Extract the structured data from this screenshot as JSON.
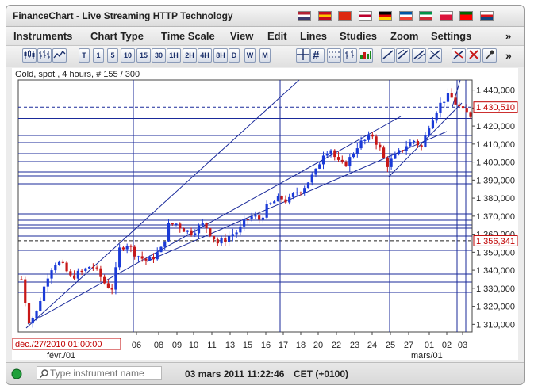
{
  "window": {
    "title": "FinanceChart - Live Streaming HTTP Technology"
  },
  "flags": [
    {
      "name": "flag-us-icon",
      "colors": [
        "#b22234",
        "#ffffff",
        "#3c3b6e"
      ]
    },
    {
      "name": "flag-spain-icon",
      "colors": [
        "#c60b1e",
        "#ffc400",
        "#c60b1e"
      ]
    },
    {
      "name": "flag-china-icon",
      "colors": [
        "#de2910",
        "#de2910",
        "#de2910"
      ]
    },
    {
      "name": "flag-japan-icon",
      "colors": [
        "#ffffff",
        "#bc002d",
        "#ffffff"
      ]
    },
    {
      "name": "flag-germany-icon",
      "colors": [
        "#000000",
        "#dd0000",
        "#ffce00"
      ]
    },
    {
      "name": "flag-france-icon",
      "colors": [
        "#0055a4",
        "#ffffff",
        "#ef4135"
      ]
    },
    {
      "name": "flag-italy-icon",
      "colors": [
        "#009246",
        "#ffffff",
        "#ce2b37"
      ]
    },
    {
      "name": "flag-poland-icon",
      "colors": [
        "#ffffff",
        "#dc143c",
        "#dc143c"
      ]
    },
    {
      "name": "flag-portugal-icon",
      "colors": [
        "#006600",
        "#ff0000",
        "#ff0000"
      ]
    },
    {
      "name": "flag-czech-icon",
      "colors": [
        "#ffffff",
        "#d7141a",
        "#11457e"
      ]
    }
  ],
  "menu": [
    "Instruments",
    "Chart Type",
    "Time Scale",
    "View",
    "Edit",
    "Lines",
    "Studies",
    "Zoom",
    "Settings"
  ],
  "menu_more": "»",
  "toolbar": {
    "chart_type_icons": [
      "candlestick-chart-icon",
      "bar-chart-icon",
      "line-chart-icon"
    ],
    "periods": [
      "T",
      "1",
      "5",
      "10",
      "15",
      "30",
      "1H",
      "2H",
      "4H",
      "8H",
      "D",
      "W",
      "M"
    ],
    "tools": [
      "crosshair-icon",
      "grid-icon",
      "dotted-line-icon",
      "ohlc-icon",
      "volume-icon",
      "draw-line-1-icon",
      "draw-line-2-icon",
      "draw-line-3-icon",
      "draw-line-4-icon",
      "remove-lines-icon",
      "delete-icon",
      "pin-icon"
    ],
    "more": "»"
  },
  "chart": {
    "header": "Gold, spot , 4 hours, # 155 / 300",
    "price_label_current": "1 430,510",
    "price_label_ref": "1 356,341",
    "crosshair_time": "déc./27/2010 01:00:00",
    "month_labels": [
      "févr./01",
      "mars/01"
    ],
    "colors": {
      "up": "#1a3ad8",
      "down": "#c81818",
      "grid": "#1a2a9a",
      "axis_label": "#c00000"
    }
  },
  "chart_data": {
    "type": "candlestick",
    "instrument": "Gold, spot",
    "period": "4 hours",
    "y_ticks": [
      "1 440,000",
      "1 430,000",
      "1 420,000",
      "1 410,000",
      "1 400,000",
      "1 390,000",
      "1 380,000",
      "1 370,000",
      "1 360,000",
      "1 350,000",
      "1 340,000",
      "1 330,000",
      "1 320,000",
      "1 310,000"
    ],
    "y_values": [
      1440,
      1430,
      1420,
      1410,
      1400,
      1390,
      1380,
      1370,
      1360,
      1350,
      1340,
      1330,
      1320,
      1310
    ],
    "x_ticks": [
      "06",
      "08",
      "09",
      "10",
      "11",
      "13",
      "15",
      "16",
      "17",
      "18",
      "20",
      "22",
      "23",
      "24",
      "25",
      "27",
      "01",
      "02",
      "03"
    ],
    "ylim": [
      1305,
      1444
    ],
    "current_price": 1430.51,
    "reference_price": 1356.341,
    "close_trace": [
      1335,
      1312,
      1315,
      1328,
      1340,
      1345,
      1342,
      1336,
      1338,
      1340,
      1343,
      1338,
      1332,
      1330,
      1352,
      1355,
      1350,
      1347,
      1345,
      1348,
      1352,
      1365,
      1366,
      1363,
      1361,
      1363,
      1366,
      1360,
      1355,
      1357,
      1360,
      1362,
      1368,
      1370,
      1368,
      1375,
      1378,
      1380,
      1378,
      1383,
      1385,
      1390,
      1395,
      1405,
      1408,
      1400,
      1398,
      1403,
      1410,
      1412,
      1415,
      1408,
      1398,
      1402,
      1406,
      1410,
      1412,
      1408,
      1420,
      1428,
      1434,
      1437,
      1432,
      1428,
      1426
    ]
  },
  "status": {
    "search_placeholder": "Type instrument name",
    "datetime": "03 mars 2011 11:22:46",
    "timezone": "CET (+0100)",
    "connection_indicator": "green"
  }
}
